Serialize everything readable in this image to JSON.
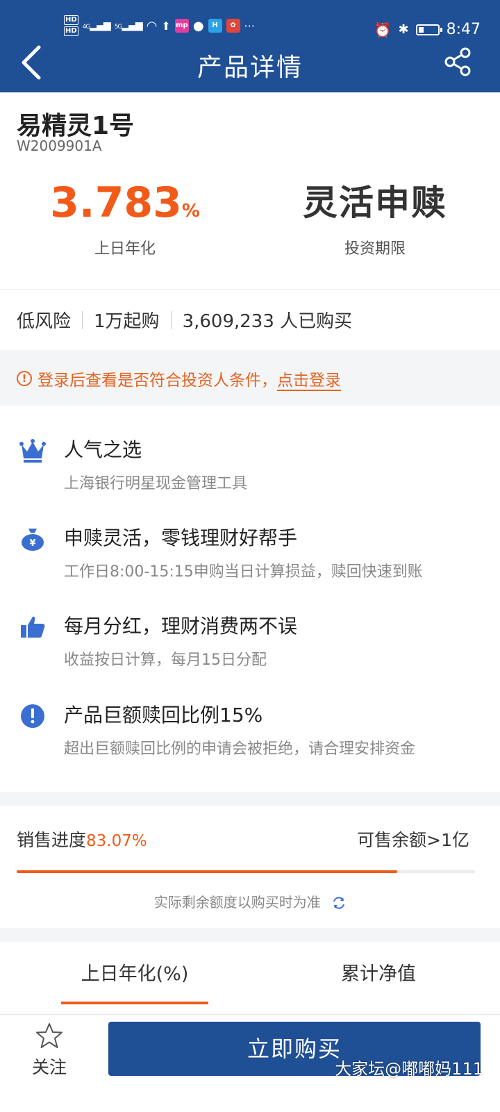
{
  "status_bar": {
    "hd1": "HD",
    "hd2": "HD",
    "signal1": "4G",
    "signal2": "5G",
    "app_mp": "mp",
    "app_h": "H",
    "more": "···",
    "time": "8:47",
    "battery_level": 0.3
  },
  "header": {
    "title": "产品详情"
  },
  "product": {
    "name": "易精灵1号",
    "code": "W2009901A",
    "rate_value": "3.783",
    "rate_unit": "%",
    "rate_label": "上日年化",
    "term_value": "灵活申赎",
    "term_label": "投资期限"
  },
  "tags": {
    "risk": "低风险",
    "min_buy": "1万起购",
    "buyers": "3,609,233 人已购买"
  },
  "notice": {
    "text": "登录后查看是否符合投资人条件，",
    "link": "点击登录"
  },
  "features": [
    {
      "icon": "crown-icon",
      "title": "人气之选",
      "desc": "上海银行明星现金管理工具"
    },
    {
      "icon": "money-bag-icon",
      "title": "申赎灵活，零钱理财好帮手",
      "desc": "工作日8:00-15:15申购当日计算损益，赎回快速到账"
    },
    {
      "icon": "thumbs-up-icon",
      "title": "每月分红，理财消费两不误",
      "desc": "收益按日计算，每月15日分配"
    },
    {
      "icon": "exclamation-icon",
      "title": "产品巨额赎回比例15%",
      "desc": "超出巨额赎回比例的申请会被拒绝，请合理安排资金"
    }
  ],
  "sales": {
    "label": "销售进度",
    "percent_text": "83.07%",
    "percent": 83.07,
    "remaining": "可售余额>1亿",
    "note": "实际剩余额度以购买时为准"
  },
  "tabs": [
    {
      "label": "上日年化(%)",
      "active": true
    },
    {
      "label": "累计净值",
      "active": false
    }
  ],
  "bottom": {
    "follow_label": "关注",
    "buy_label": "立即购买",
    "watermark": "大家坛@嘟嘟妈111"
  },
  "colors": {
    "brand": "#1f4f95",
    "accent": "#f25a19",
    "icon_blue": "#3a6fd1"
  }
}
